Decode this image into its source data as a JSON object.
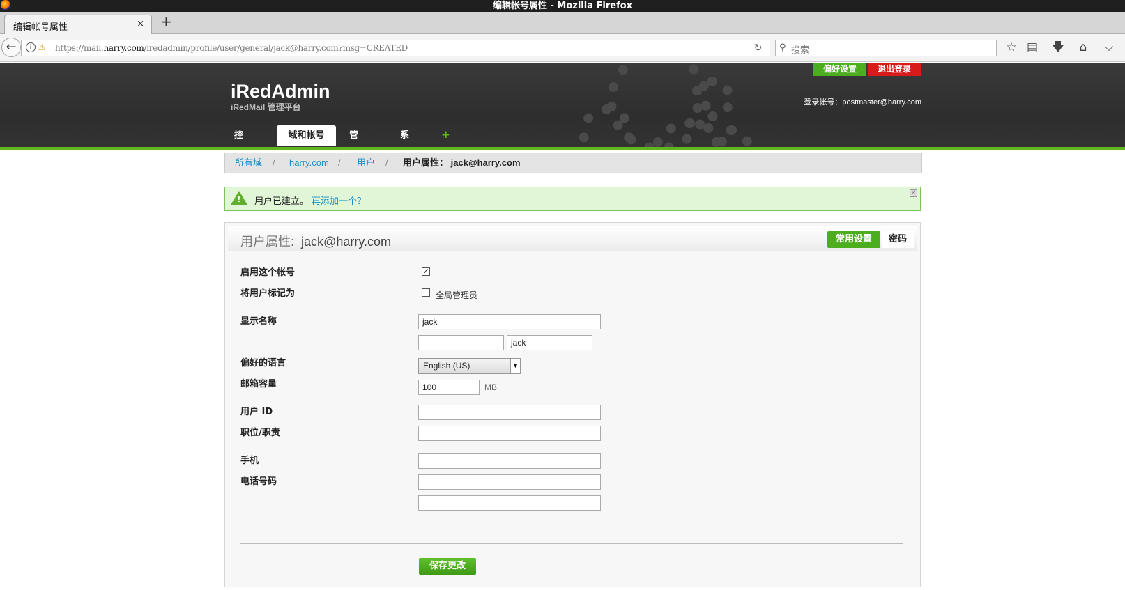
{
  "window": {
    "title": "编辑帐号属性 - Mozilla Firefox"
  },
  "browser": {
    "tab_title": "编辑帐号属性",
    "tab_close": "×",
    "new_tab": "+",
    "url_prefix": "https://mail.",
    "url_domain": "harry.com",
    "url_rest": "/iredadmin/profile/user/general/jack@harry.com?msg=CREATED",
    "search_placeholder": "搜索"
  },
  "header": {
    "brand": "iRedAdmin",
    "subbrand": "iRedMail 管理平台",
    "pref_button": "偏好设置",
    "logout_button": "退出登录",
    "login_as": "登录帐号：postmaster@harry.com",
    "nav": {
      "dashboard": "控制台",
      "domains": "域和帐号",
      "admins": "管理员",
      "system": "系统",
      "add": "添加..."
    }
  },
  "breadcrumb": {
    "all_domains": "所有域",
    "domain": "harry.com",
    "users": "用户",
    "current_label": "用户属性：",
    "current_value": "jack@harry.com",
    "sep": "/"
  },
  "notice": {
    "text": "用户已建立。",
    "link": "再添加一个？"
  },
  "form": {
    "title_label": "用户属性:",
    "title_value": "jack@harry.com",
    "tab_general": "常用设置",
    "tab_password": "密码",
    "enable_label": "启用这个帐号",
    "enable_checked": "✓",
    "mark_label": "将用户标记为",
    "global_admin_label": "全局管理员",
    "display_name_label": "显示名称",
    "display_name_value": "jack",
    "first_name_value": "",
    "last_name_value": "jack",
    "language_label": "偏好的语言",
    "language_value": "English (US)",
    "quota_label": "邮箱容量",
    "quota_value": "100",
    "quota_unit": "MB",
    "user_id_label": "用户 ID",
    "job_title_label": "职位/职责",
    "mobile_label": "手机",
    "phone_label": "电话号码",
    "save_button": "保存更改"
  }
}
